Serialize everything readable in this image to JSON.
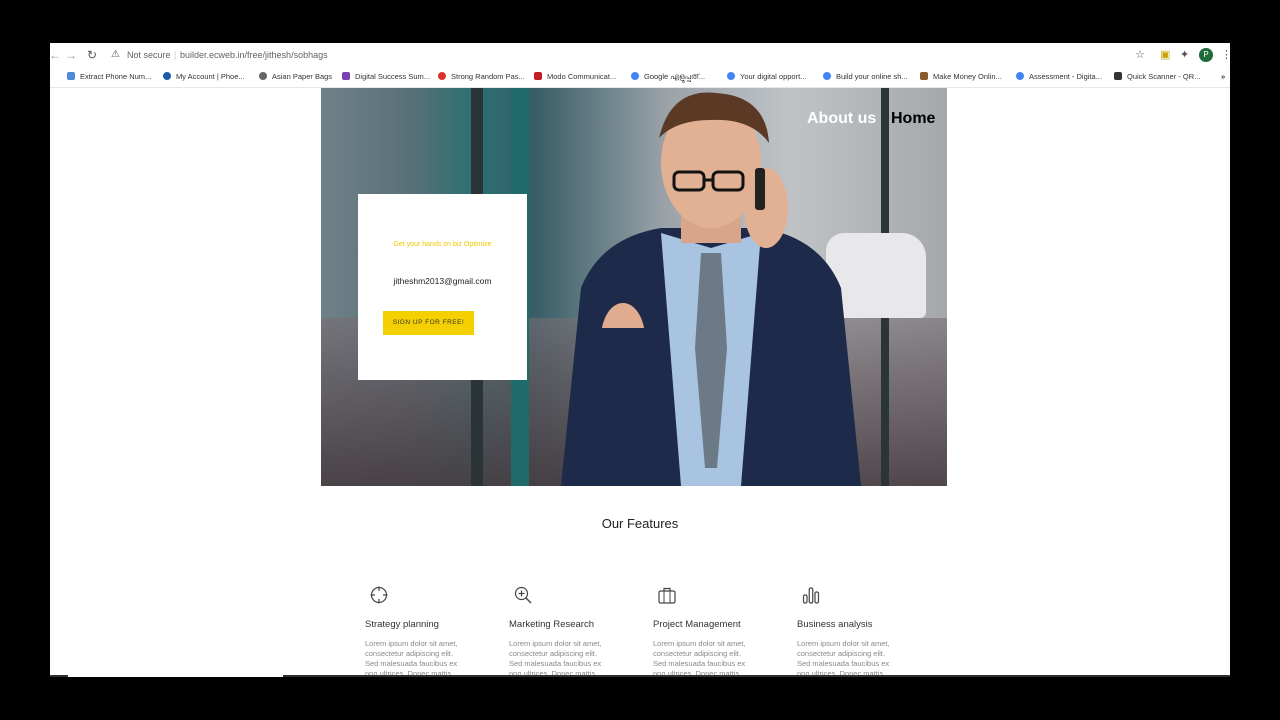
{
  "browser": {
    "security_label": "Not secure",
    "url": "builder.ecweb.in/free/jithesh/sobhags",
    "profile_initial": "P"
  },
  "bookmarks": [
    {
      "label": "Extract Phone Num...",
      "color": "#4d8bd8"
    },
    {
      "label": "My Account | Phoe...",
      "color": "#1e5aa8"
    },
    {
      "label": "Asian Paper Bags",
      "color": "#666666"
    },
    {
      "label": "Digital Success Sum...",
      "color": "#7a3fb0"
    },
    {
      "label": "Strong Random Pas...",
      "color": "#d9342b"
    },
    {
      "label": "Modo Communicat...",
      "color": "#c41e2a"
    },
    {
      "label": "Google എളുപ്പത്...",
      "color": "#4285f4"
    },
    {
      "label": "Your digital opport...",
      "color": "#4285f4"
    },
    {
      "label": "Build your online sh...",
      "color": "#4285f4"
    },
    {
      "label": "Make Money Onlin...",
      "color": "#8a5a2b"
    },
    {
      "label": "Assessment - Digita...",
      "color": "#4285f4"
    },
    {
      "label": "Quick Scanner - QR...",
      "color": "#333333"
    }
  ],
  "site": {
    "nav": {
      "about": "About us",
      "home": "Home"
    },
    "signup": {
      "tagline": "Get your hands on biz Optimize",
      "email": "jitheshm2013@gmail.com",
      "button": "SIGN UP FOR FREE!"
    },
    "features_title": "Our Features",
    "features": [
      {
        "icon": "crosshair-icon",
        "name": "Strategy planning",
        "desc": "Lorem ipsum dolor sit amet, consectetur adipiscing elit. Sed malesuada faucibus ex non ultrices. Donec mattis"
      },
      {
        "icon": "zoom-in-icon",
        "name": "Marketing Research",
        "desc": "Lorem ipsum dolor sit amet, consectetur adipiscing elit. Sed malesuada faucibus ex non ultrices. Donec mattis"
      },
      {
        "icon": "briefcase-icon",
        "name": "Project Management",
        "desc": "Lorem ipsum dolor sit amet, consectetur adipiscing elit. Sed malesuada faucibus ex non ultrices. Donec mattis"
      },
      {
        "icon": "bar-chart-icon",
        "name": "Business analysis",
        "desc": "Lorem ipsum dolor sit amet, consectetur adipiscing elit. Sed malesuada faucibus ex non ultrices. Donec mattis"
      }
    ]
  }
}
